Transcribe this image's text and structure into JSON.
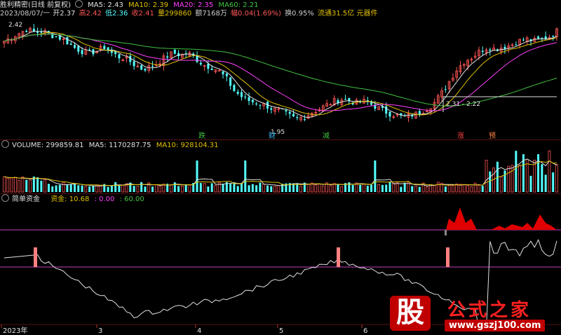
{
  "colors": {
    "up": "#ff5555",
    "down": "#54ffff",
    "ma5": "#e0e0e0",
    "ma10": "#e0c000",
    "ma20": "#ff40ff",
    "ma60": "#40c040",
    "signal": "#ff2020"
  },
  "main_header": {
    "title": "胜利精密(日线 前复权)",
    "ma5": "MA5: 2.43",
    "ma10": "MA10: 2.39",
    "ma20": "MA20: 2.35",
    "ma60": "MA60: 2.21"
  },
  "ohlc_line": {
    "date": "2023/08/07/一",
    "open": "开2.37",
    "high": "高2.42",
    "low": "低2.36",
    "close": "收2.41",
    "volume": "量299860",
    "amount": "额7168万",
    "change": "幅0.04(1.69%)",
    "turnover": "换0.95%",
    "float": "流通31.5亿 元器件"
  },
  "price_annotations": {
    "hi_label": "2.42",
    "low_label": "1.95",
    "box_label": "2.31 - 2.22"
  },
  "event_marks": [
    {
      "text": "跌",
      "color": "#40c040"
    },
    {
      "text": "财",
      "color": "#40c0ff"
    },
    {
      "text": "减",
      "color": "#40c040"
    },
    {
      "text": "涨",
      "color": "#ff4040"
    },
    {
      "text": "预",
      "color": "#ff8040"
    }
  ],
  "volume_header": {
    "label": "VOLUME: 299859.81",
    "ma5": "MA5: 1170287.75",
    "ma10": "MA10: 928104.31"
  },
  "indicator_header": {
    "name": "简单资金",
    "fund": "资金: 10.68",
    "v2": ": 0.00",
    "v3": ": 60.00"
  },
  "x_axis": [
    "2023年",
    "3",
    "4",
    "5",
    "6"
  ],
  "logo": {
    "char": "股",
    "title": "公式之家",
    "url": "www.gszj100.com"
  },
  "chart_data": [
    {
      "type": "candlestick",
      "title": "胜利精密(日线 前复权)",
      "series": [
        {
          "name": "close",
          "values": [
            2.36,
            2.38,
            2.4,
            2.42,
            2.4,
            2.41,
            2.39,
            2.38,
            2.36,
            2.33,
            2.31,
            2.3,
            2.31,
            2.33,
            2.3,
            2.28,
            2.27,
            2.24,
            2.22,
            2.23,
            2.25,
            2.28,
            2.3,
            2.29,
            2.3,
            2.27,
            2.24,
            2.23,
            2.21,
            2.17,
            2.11,
            2.08,
            2.06,
            2.05,
            2.04,
            2.02,
            2.01,
            1.99,
            1.97,
            1.98,
            2.0,
            2.02,
            2.04,
            2.06,
            2.07,
            2.06,
            2.05,
            2.06,
            2.04,
            2.02,
            2.0,
            1.99,
            1.98,
            1.99,
            2.0,
            2.02,
            2.05,
            2.1,
            2.16,
            2.22,
            2.26,
            2.28,
            2.31,
            2.33,
            2.32,
            2.33,
            2.34,
            2.36,
            2.37,
            2.36,
            2.37,
            2.38,
            2.41
          ]
        }
      ]
    },
    {
      "type": "bar",
      "title": "VOLUME",
      "series": [
        {
          "name": "VOLUME",
          "values": [
            299859.81
          ]
        },
        {
          "name": "MA5",
          "values": [
            1170287.75
          ]
        },
        {
          "name": "MA10",
          "values": [
            928104.31
          ]
        }
      ]
    },
    {
      "type": "line",
      "title": "简单资金",
      "series": [
        {
          "name": "资金",
          "values": [
            10.68
          ]
        }
      ],
      "reference_lines": [
        0,
        60
      ]
    }
  ]
}
